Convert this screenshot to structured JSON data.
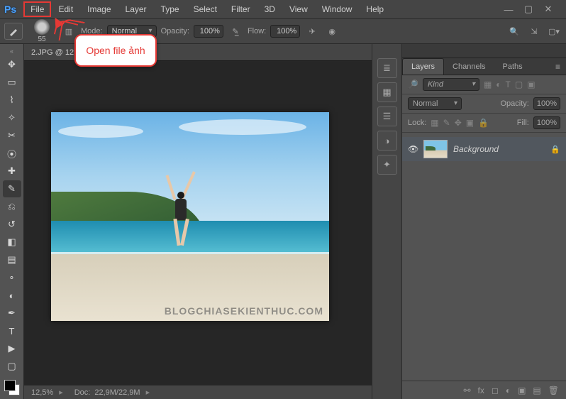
{
  "app": {
    "logo_text": "Ps"
  },
  "menus": [
    "File",
    "Edit",
    "Image",
    "Layer",
    "Type",
    "Select",
    "Filter",
    "3D",
    "View",
    "Window",
    "Help"
  ],
  "menu_highlight_index": 0,
  "callout": {
    "text": "Open file ảnh"
  },
  "options": {
    "brush_size": "55",
    "mode_label": "Mode:",
    "mode_value": "Normal",
    "opacity_label": "Opacity:",
    "opacity_value": "100%",
    "flow_label": "Flow:",
    "flow_value": "100%"
  },
  "document": {
    "tab_title": "2.JPG @ 12,5% (RGB/8)",
    "zoom": "12,5%",
    "doc_size_label": "Doc:",
    "doc_size_value": "22,9M/22,9M",
    "watermark": "BLOGCHIASEKIENTHUC.COM"
  },
  "tools": [
    {
      "name": "move-tool",
      "glyph": "✥"
    },
    {
      "name": "marquee-tool",
      "glyph": "▭"
    },
    {
      "name": "lasso-tool",
      "glyph": "⌇"
    },
    {
      "name": "magic-wand-tool",
      "glyph": "✧"
    },
    {
      "name": "crop-tool",
      "glyph": "✂"
    },
    {
      "name": "eyedropper-tool",
      "glyph": "⦿"
    },
    {
      "name": "healing-brush-tool",
      "glyph": "✚"
    },
    {
      "name": "brush-tool",
      "glyph": "✎",
      "active": true
    },
    {
      "name": "clone-stamp-tool",
      "glyph": "⎌"
    },
    {
      "name": "history-brush-tool",
      "glyph": "↺"
    },
    {
      "name": "eraser-tool",
      "glyph": "◧"
    },
    {
      "name": "gradient-tool",
      "glyph": "▤"
    },
    {
      "name": "blur-tool",
      "glyph": "∘"
    },
    {
      "name": "dodge-tool",
      "glyph": "◐"
    },
    {
      "name": "pen-tool",
      "glyph": "✒"
    },
    {
      "name": "type-tool",
      "glyph": "T"
    },
    {
      "name": "path-select-tool",
      "glyph": "▶"
    },
    {
      "name": "rectangle-tool",
      "glyph": "▢"
    }
  ],
  "dock_icons": [
    {
      "name": "history-panel-icon",
      "glyph": "≣"
    },
    {
      "name": "swatches-panel-icon",
      "glyph": "▦"
    },
    {
      "name": "libraries-panel-icon",
      "glyph": "☰"
    },
    {
      "name": "adjustments-panel-icon",
      "glyph": "◑"
    },
    {
      "name": "properties-panel-icon",
      "glyph": "✦"
    }
  ],
  "layers_panel": {
    "tabs": [
      "Layers",
      "Channels",
      "Paths"
    ],
    "active_tab": 0,
    "kind_label": "Kind",
    "filter_search_placeholder": "Kind",
    "blend_mode": "Normal",
    "opacity_label": "Opacity:",
    "opacity_value": "100%",
    "lock_label": "Lock:",
    "fill_label": "Fill:",
    "fill_value": "100%",
    "layer_name": "Background",
    "footer_icons": [
      {
        "name": "link-layers-icon",
        "glyph": "⚯"
      },
      {
        "name": "fx-icon",
        "glyph": "fx"
      },
      {
        "name": "mask-icon",
        "glyph": "◻"
      },
      {
        "name": "adjustment-icon",
        "glyph": "◐"
      },
      {
        "name": "group-icon",
        "glyph": "▣"
      },
      {
        "name": "new-layer-icon",
        "glyph": "▤"
      },
      {
        "name": "trash-icon",
        "glyph": "🗑"
      }
    ]
  }
}
